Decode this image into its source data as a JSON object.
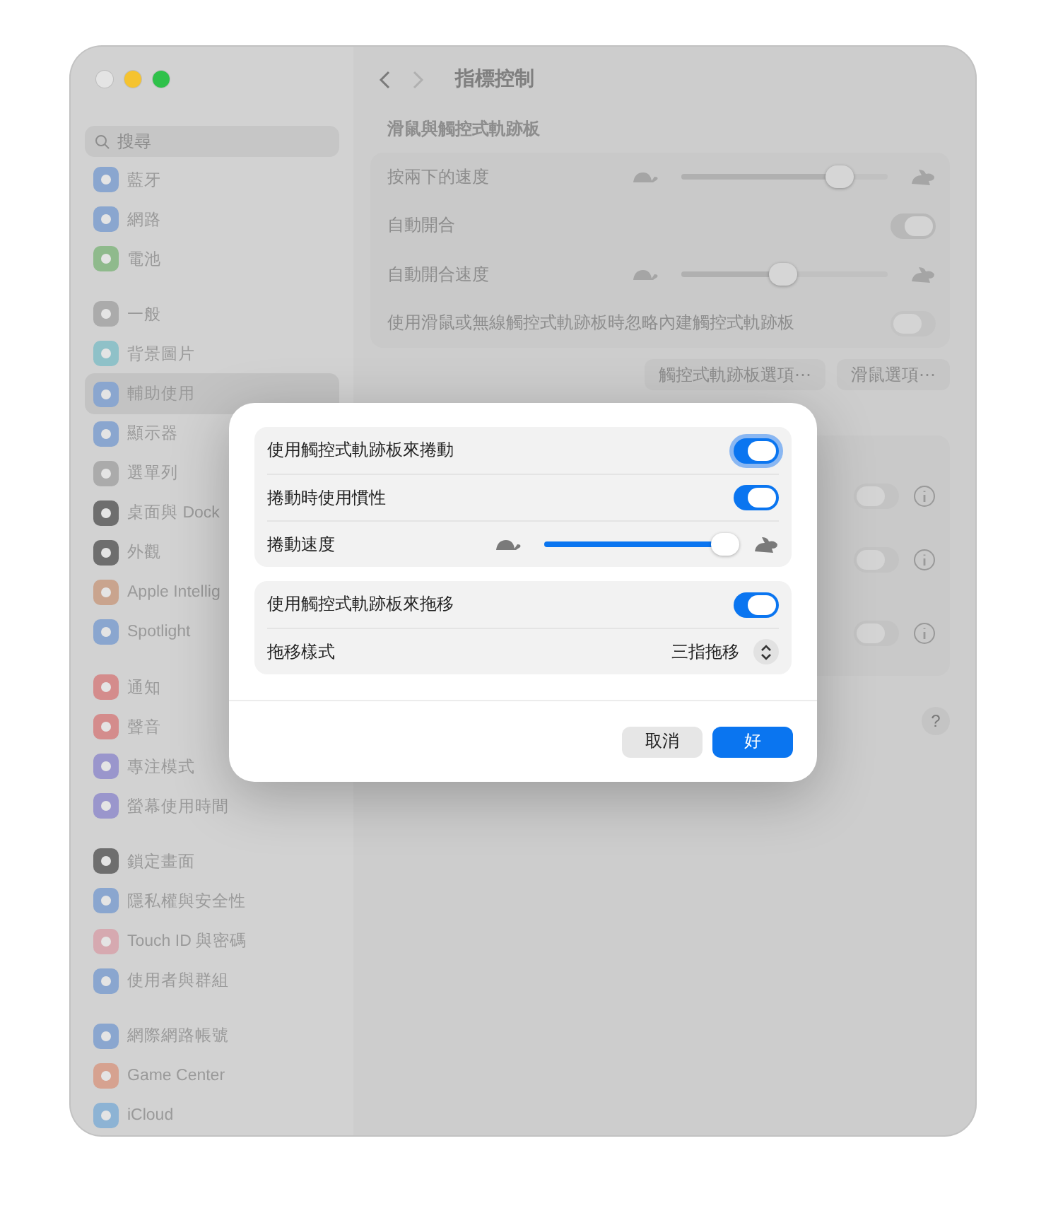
{
  "window": {
    "traffic_lights": [
      {
        "color": "#e4e4e4"
      },
      {
        "color": "#f5c330"
      },
      {
        "color": "#2fc14a"
      }
    ],
    "sidebar": {
      "search": {
        "placeholder": "搜尋"
      },
      "groups": [
        [
          {
            "label": "藍牙",
            "color": "#8aa6cf",
            "selected": false
          },
          {
            "label": "網路",
            "color": "#8aa6cf",
            "selected": false
          },
          {
            "label": "電池",
            "color": "#8fba8c",
            "selected": false
          }
        ],
        [
          {
            "label": "一般",
            "color": "#ababab",
            "selected": false
          },
          {
            "label": "背景圖片",
            "color": "#8fc1c8",
            "selected": false
          },
          {
            "label": "輔助使用",
            "color": "#8aa6cf",
            "selected": true
          },
          {
            "label": "顯示器",
            "color": "#8aa6cf",
            "selected": false
          },
          {
            "label": "選單列",
            "color": "#ababab",
            "selected": false
          },
          {
            "label": "桌面與 Dock",
            "color": "#6e6e6e",
            "selected": false
          },
          {
            "label": "外觀",
            "color": "#6e6e6e",
            "selected": false
          },
          {
            "label": "Apple Intellig",
            "color": "#c9a48e",
            "selected": false
          },
          {
            "label": "Spotlight",
            "color": "#8aa6cf",
            "selected": false
          }
        ],
        [
          {
            "label": "通知",
            "color": "#d48c8c",
            "selected": false
          },
          {
            "label": "聲音",
            "color": "#d48c8c",
            "selected": false
          },
          {
            "label": "專注模式",
            "color": "#9a96cc",
            "selected": false
          },
          {
            "label": "螢幕使用時間",
            "color": "#9a96cc",
            "selected": false
          }
        ],
        [
          {
            "label": "鎖定畫面",
            "color": "#6e6e6e",
            "selected": false
          },
          {
            "label": "隱私權與安全性",
            "color": "#8aa6cf",
            "selected": false
          },
          {
            "label": "Touch ID 與密碼",
            "color": "#d6a9b0",
            "selected": false
          },
          {
            "label": "使用者與群組",
            "color": "#8aa6cf",
            "selected": false
          }
        ],
        [
          {
            "label": "網際網路帳號",
            "color": "#8aa6cf",
            "selected": false
          },
          {
            "label": "Game Center",
            "color": "#d6a290",
            "selected": false
          },
          {
            "label": "iCloud",
            "color": "#8db3d4",
            "selected": false
          }
        ]
      ]
    },
    "toolbar": {
      "title": "指標控制"
    },
    "section": {
      "title": "滑鼠與觸控式軌跡板",
      "rows": [
        {
          "kind": "slider",
          "label": "按兩下的速度",
          "level": 0.77
        },
        {
          "kind": "toggle",
          "label": "自動開合",
          "on": true
        },
        {
          "kind": "slider",
          "label": "自動開合速度",
          "level": 0.49
        },
        {
          "kind": "toggle",
          "label": "使用滑鼠或無線觸控式軌跡板時忽略內建觸控式軌跡板",
          "on": false
        }
      ],
      "buttons": [
        "觸控式軌跡板選項⋯",
        "滑鼠選項⋯"
      ]
    },
    "hidden_rows": [
      {
        "on": false
      },
      {
        "on": false
      },
      {
        "on": false
      }
    ],
    "help": "?"
  },
  "sheet": {
    "groups": [
      [
        {
          "kind": "toggle",
          "label": "使用觸控式軌跡板來捲動",
          "on": true,
          "focused": true
        },
        {
          "kind": "toggle",
          "label": "捲動時使用慣性",
          "on": true,
          "focused": false
        },
        {
          "kind": "slider",
          "label": "捲動速度",
          "level": 0.97
        }
      ],
      [
        {
          "kind": "toggle",
          "label": "使用觸控式軌跡板來拖移",
          "on": true,
          "focused": false
        },
        {
          "kind": "select",
          "label": "拖移樣式",
          "value": "三指拖移"
        }
      ]
    ],
    "buttons": [
      {
        "label": "取消",
        "default": false
      },
      {
        "label": "好",
        "default": true
      }
    ]
  }
}
